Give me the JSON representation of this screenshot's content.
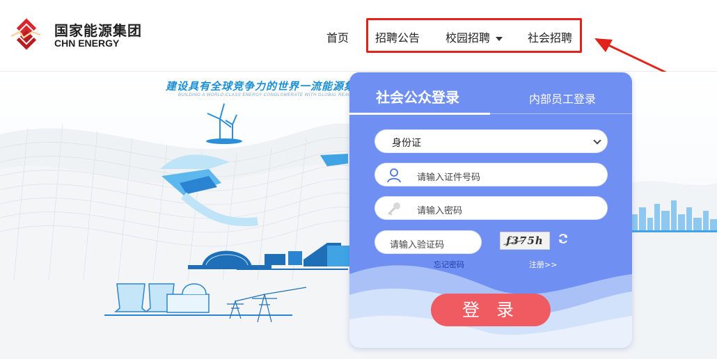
{
  "brand": {
    "name_cn": "国家能源集团",
    "name_en": "CHN ENERGY",
    "logo_icon": "chn-energy-logo"
  },
  "nav": {
    "home": "首页",
    "notice": "招聘公告",
    "campus": "校园招聘",
    "social": "社会招聘"
  },
  "hero": {
    "slogan": "建设具有全球竞争力的世界一流能源集",
    "slogan_en": "BUILDING A WORLD-CLASS ENERGY CONGLOMERATE WITH GLOBAL REACH"
  },
  "login": {
    "tabs": {
      "public": "社会公众登录",
      "internal": "内部员工登录"
    },
    "id_type": {
      "selected": "身份证"
    },
    "id_placeholder": "请输入证件号码",
    "password_placeholder": "请输入密码",
    "captcha_placeholder": "请输入验证码",
    "captcha_text": "f375h",
    "forgot_password": "忘记密码",
    "register": "注册>>",
    "submit": "登 录"
  },
  "colors": {
    "card": "#6f8ff3",
    "button": "#f05b61",
    "highlight": "#e2231a",
    "logo_red": "#d7262c"
  }
}
